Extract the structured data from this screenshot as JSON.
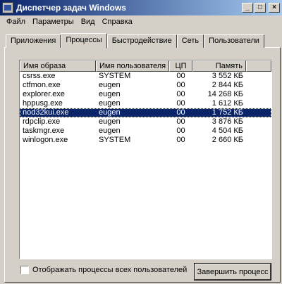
{
  "window": {
    "title": "Диспетчер задач Windows",
    "controls": {
      "minimize": "_",
      "maximize": "□",
      "close": "×"
    }
  },
  "menu": [
    "Файл",
    "Параметры",
    "Вид",
    "Справка"
  ],
  "tabs": [
    "Приложения",
    "Процессы",
    "Быстродействие",
    "Сеть",
    "Пользователи"
  ],
  "active_tab": "Процессы",
  "table": {
    "columns": [
      "Имя образа",
      "Имя пользователя",
      "ЦП",
      "Память"
    ],
    "rows": [
      {
        "name": "csrss.exe",
        "user": "SYSTEM",
        "cpu": "00",
        "mem": "3 552 КБ"
      },
      {
        "name": "ctfmon.exe",
        "user": "eugen",
        "cpu": "00",
        "mem": "2 844 КБ"
      },
      {
        "name": "explorer.exe",
        "user": "eugen",
        "cpu": "00",
        "mem": "14 268 КБ"
      },
      {
        "name": "hppusg.exe",
        "user": "eugen",
        "cpu": "00",
        "mem": "1 612 КБ"
      },
      {
        "name": "nod32kui.exe",
        "user": "eugen",
        "cpu": "00",
        "mem": "1 752 КБ"
      },
      {
        "name": "rdpclip.exe",
        "user": "eugen",
        "cpu": "00",
        "mem": "3 876 КБ"
      },
      {
        "name": "taskmgr.exe",
        "user": "eugen",
        "cpu": "00",
        "mem": "4 504 КБ"
      },
      {
        "name": "winlogon.exe",
        "user": "SYSTEM",
        "cpu": "00",
        "mem": "2 660 КБ"
      }
    ],
    "selected_index": 4
  },
  "show_all_users": {
    "label": "Отображать процессы всех пользователей",
    "checked": false
  },
  "end_process_button": "Завершить процесс",
  "colors": {
    "title_gradient_start": "#0a246a",
    "title_gradient_end": "#a6caf0",
    "face": "#d4d0c8",
    "selection": "#0a246a"
  }
}
